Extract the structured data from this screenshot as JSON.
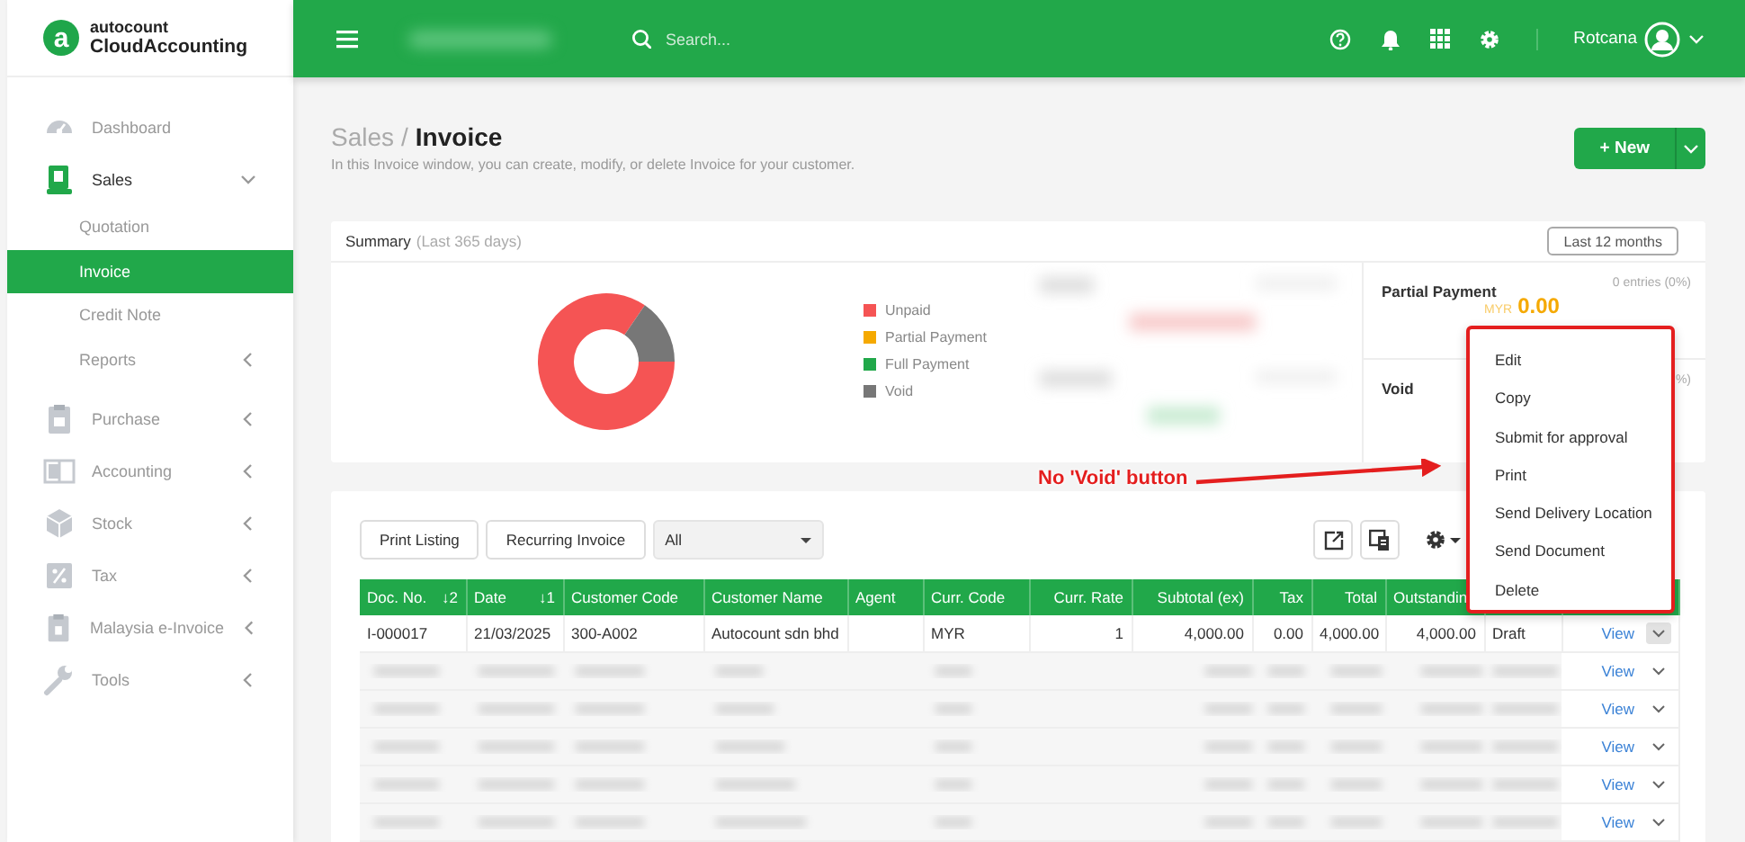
{
  "brand": {
    "mark": "a",
    "name_top": "autocount",
    "name_bottom": "CloudAccounting"
  },
  "sidebar": {
    "items": [
      {
        "label": "Dashboard"
      },
      {
        "label": "Sales",
        "expanded": true,
        "children": [
          {
            "label": "Quotation",
            "selected": false
          },
          {
            "label": "Invoice",
            "selected": true
          },
          {
            "label": "Credit Note",
            "selected": false
          },
          {
            "label": "Reports",
            "selected": false,
            "expanded": false
          }
        ]
      },
      {
        "label": "Purchase",
        "expanded": false
      },
      {
        "label": "Accounting",
        "expanded": false
      },
      {
        "label": "Stock",
        "expanded": false
      },
      {
        "label": "Tax",
        "expanded": false
      },
      {
        "label": "Malaysia e-Invoice",
        "expanded": false
      },
      {
        "label": "Tools",
        "expanded": false
      }
    ]
  },
  "topbar": {
    "search": {
      "placeholder": "Search..."
    },
    "user": {
      "name": "Rotcana"
    }
  },
  "page": {
    "parent": "Sales",
    "separator": "/",
    "title": "Invoice",
    "subtitle": "In this Invoice window, you can create, modify, or delete Invoice for your customer.",
    "new_button": "+ New"
  },
  "summary": {
    "title": "Summary",
    "period": "(Last 365 days)",
    "range_button": "Last 12 months",
    "legend": [
      {
        "label": "Unpaid",
        "color": "#f55454"
      },
      {
        "label": "Partial Payment",
        "color": "#f5a900"
      },
      {
        "label": "Full Payment",
        "color": "#21a84a"
      },
      {
        "label": "Void",
        "color": "#777777"
      }
    ],
    "partial_payment": {
      "label": "Partial Payment",
      "entries": "0 entries (0%)",
      "currency": "MYR",
      "amount": "0.00"
    },
    "void": {
      "label": "Void",
      "entries": "%)"
    }
  },
  "listing": {
    "buttons": [
      "Print Listing",
      "Recurring Invoice"
    ],
    "filter": {
      "value": "All"
    },
    "columns": [
      {
        "label": "Doc. No.",
        "sort": "↓2"
      },
      {
        "label": "Date",
        "sort": "↓1"
      },
      {
        "label": "Customer Code"
      },
      {
        "label": "Customer Name"
      },
      {
        "label": "Agent"
      },
      {
        "label": "Curr. Code"
      },
      {
        "label": "Curr. Rate"
      },
      {
        "label": "Subtotal (ex)"
      },
      {
        "label": "Tax"
      },
      {
        "label": "Total"
      },
      {
        "label": "Outstandin"
      }
    ],
    "rows": [
      {
        "kind": "data",
        "cells": [
          "I-000017",
          "21/03/2025",
          "300-A002",
          "Autocount sdn bhd",
          "",
          "MYR",
          "1",
          "4,000.00",
          "0.00",
          "4,000.00",
          "4,000.00",
          "Draft"
        ],
        "action": "View",
        "menu_open": true
      },
      {
        "kind": "blurred",
        "action": "View",
        "menu_open": false
      },
      {
        "kind": "blurred",
        "action": "View",
        "menu_open": false
      },
      {
        "kind": "blurred",
        "action": "View",
        "menu_open": false
      },
      {
        "kind": "blurred",
        "action": "View",
        "menu_open": false
      },
      {
        "kind": "blurred",
        "action": "View",
        "menu_open": false
      }
    ]
  },
  "row_menu": {
    "highlighted": true,
    "items": [
      "Edit",
      "Copy",
      "Submit for approval",
      "Print",
      "Send Delivery Location",
      "Send Document",
      "Delete"
    ]
  },
  "annotation": {
    "text": "No 'Void' button"
  }
}
